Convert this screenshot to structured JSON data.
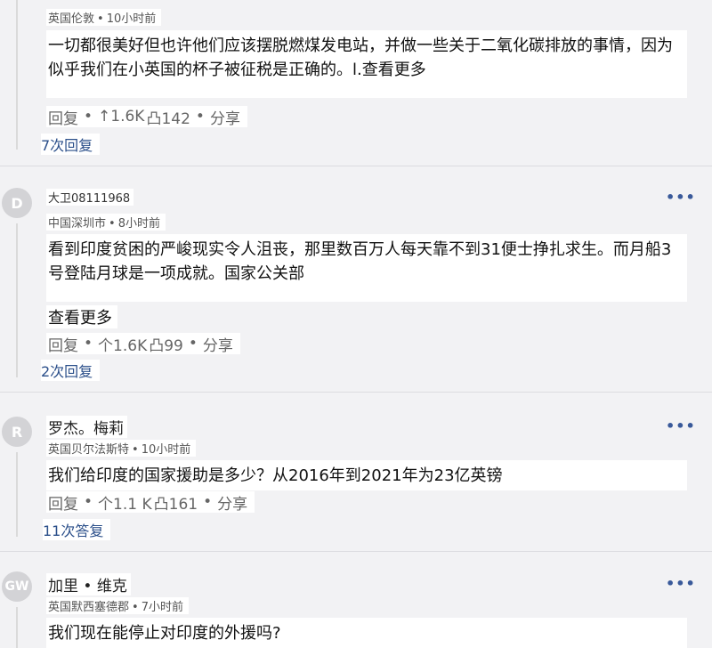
{
  "comments": [
    {
      "name": "",
      "location": "英国伦敦",
      "time": "10小时前",
      "text": "一切都很美好但也许他们应该摆脱燃煤发电站，并做一些关于二氧化碳排放的事情，因为似乎我们在小英国的杯子被征税是正确的。l.",
      "see_more": "查看更多",
      "reply": "回复",
      "upvote": "↑1.6K",
      "downvote": "凸142",
      "share": "分享",
      "replies": "7次回复"
    },
    {
      "avatar": "D",
      "name": "大卫08111968",
      "location": "中国深圳市",
      "time": "8小时前",
      "text": "看到印度贫困的严峻现实令人沮丧，那里数百万人每天靠不到31便士挣扎求生。而月船3号登陆月球是一项成就。国家公关部",
      "see_more": "查看更多",
      "reply": "回复",
      "upvote": "个1.6K",
      "downvote": "凸99",
      "share": "分享",
      "replies": "2次回复",
      "more": "•••"
    },
    {
      "avatar": "R",
      "name": "罗杰。梅莉",
      "location": "英国贝尔法斯特",
      "time": "10小时前",
      "text": "我们给印度的国家援助是多少？从2016年到2021年为23亿英镑",
      "reply": "回复",
      "upvote": "个1.1 K",
      "downvote": "凸161",
      "share": "分享",
      "replies": "11次答复",
      "more": "•••"
    },
    {
      "avatar": "GW",
      "name": "加里 • 维克",
      "location": "英国默西塞德郡",
      "time": "7小时前",
      "text": "我们现在能停止对印度的外援吗?",
      "more": "•••"
    }
  ],
  "separator": "•"
}
